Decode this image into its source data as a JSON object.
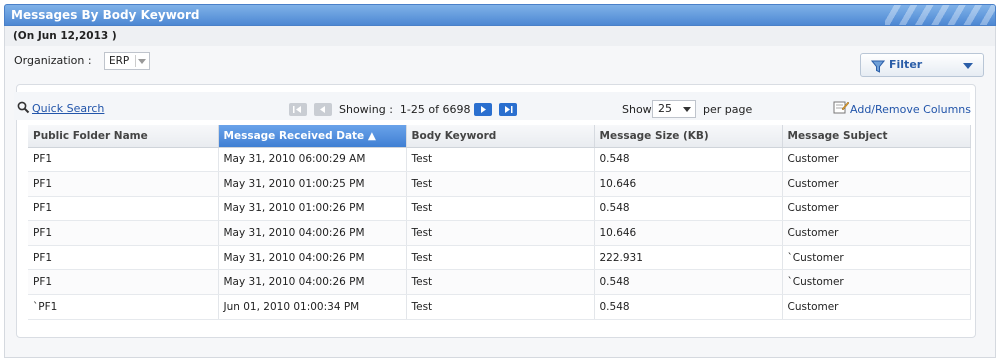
{
  "panel": {
    "title": "Messages By Body Keyword",
    "date_note": "(On Jun 12,2013 )"
  },
  "filters": {
    "organization_label": "Organization :",
    "organization_value": "ERP",
    "filter_button": "Filter"
  },
  "toolbar": {
    "quick_search": "Quick Search",
    "showing_label": "Showing :",
    "showing_range": "1-25 of 6698",
    "show_label": "Show",
    "page_size": "25",
    "per_page_label": "per page",
    "add_remove_columns": "Add/Remove Columns"
  },
  "table": {
    "columns": [
      "Public Folder Name",
      "Message Received Date ▲",
      "Body Keyword",
      "Message Size (KB)",
      "Message Subject"
    ],
    "sorted_column": 1,
    "rows": [
      [
        "PF1",
        "May 31, 2010 06:00:29 AM",
        "Test",
        "0.548",
        "Customer"
      ],
      [
        "PF1",
        "May 31, 2010 01:00:25 PM",
        "Test",
        "10.646",
        "Customer"
      ],
      [
        "PF1",
        "May 31, 2010 01:00:26 PM",
        "Test",
        "0.548",
        "Customer"
      ],
      [
        "PF1",
        "May 31, 2010 04:00:26 PM",
        "Test",
        "10.646",
        "Customer"
      ],
      [
        "PF1",
        "May 31, 2010 04:00:26 PM",
        "Test",
        "222.931",
        "`Customer"
      ],
      [
        "PF1",
        "May 31, 2010 04:00:26 PM",
        "Test",
        "0.548",
        "`Customer"
      ],
      [
        "`PF1",
        "Jun 01, 2010 01:00:34 PM",
        "Test",
        "0.548",
        "Customer"
      ]
    ]
  },
  "colors": {
    "header_blue": "#4d88d3",
    "link_blue": "#2255aa",
    "sorted_header": "#3f7fd3"
  }
}
